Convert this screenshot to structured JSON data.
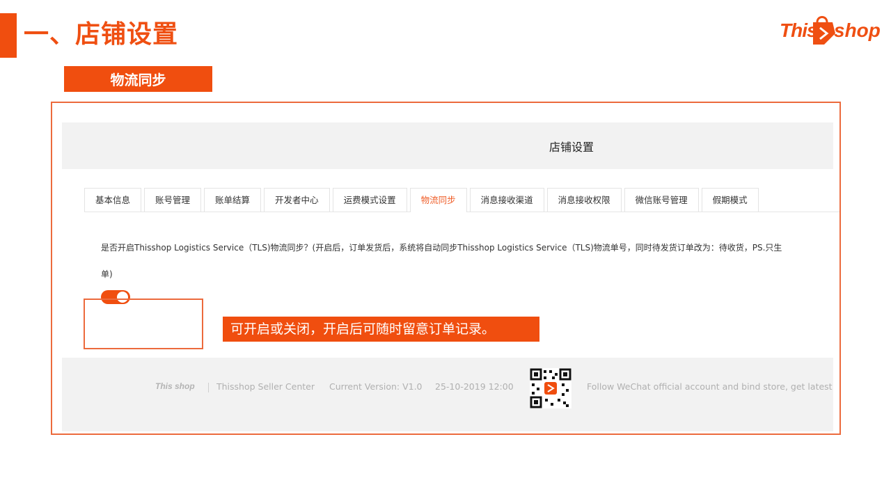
{
  "slide": {
    "title": "一、店铺设置",
    "section_label": "物流同步",
    "brand_logo": {
      "this": "This",
      "shop": "shop"
    }
  },
  "screenshot": {
    "page_title": "店铺设置",
    "tabs": [
      {
        "label": "基本信息"
      },
      {
        "label": "账号管理"
      },
      {
        "label": "账单结算"
      },
      {
        "label": "开发者中心"
      },
      {
        "label": "运费模式设置"
      },
      {
        "label": "物流同步",
        "active": true
      },
      {
        "label": "消息接收渠道"
      },
      {
        "label": "消息接收权限"
      },
      {
        "label": "微信账号管理"
      },
      {
        "label": "假期模式"
      }
    ],
    "question": "是否开启Thisshop Logistics Service（TLS)物流同步？(开启后，订单发货后，系统将自动同步Thisshop Logistics Service（TLS)物流单号，同时待发货订单改为：待收货，PS.只生",
    "question_cont": "单)",
    "toggle_on": true,
    "callout": "可开启或关闭，开启后可随时留意订单记录。",
    "footer": {
      "logo": "This shop",
      "center": "Thisshop Seller Center",
      "version": "Current Version: V1.0",
      "date": "25-10-2019 12:00",
      "follow": "Follow WeChat official account and bind store, get latest"
    }
  },
  "colors": {
    "accent": "#f04e0f",
    "frame": "#ec6a3c",
    "active_tab": "#ef5b25"
  }
}
